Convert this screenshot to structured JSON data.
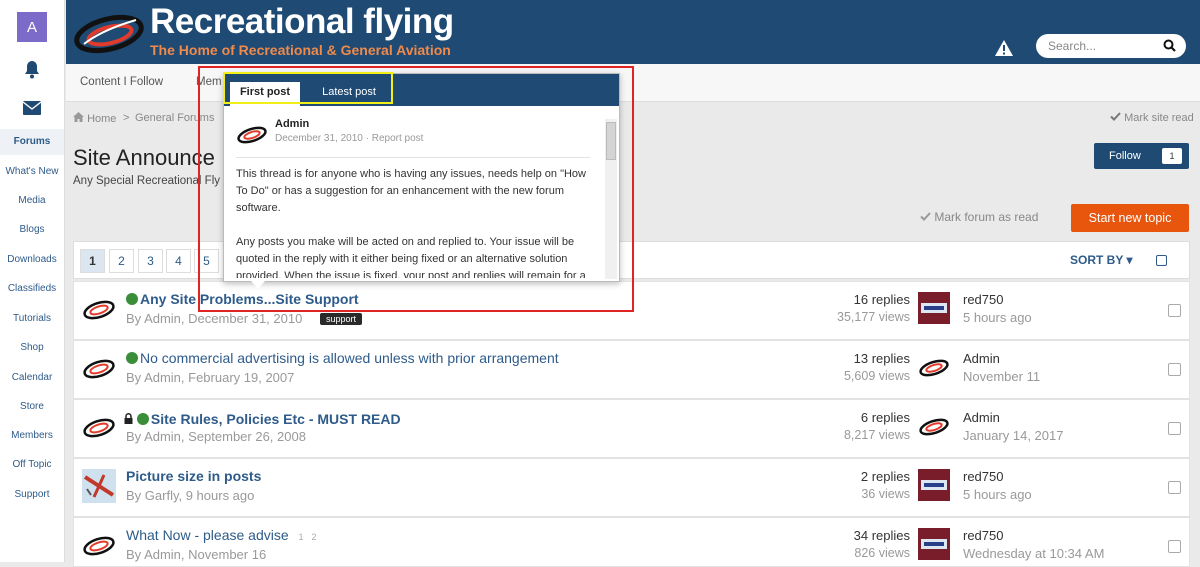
{
  "user": {
    "avatar_letter": "A"
  },
  "sidebar": {
    "items": [
      {
        "label": "Forums",
        "active": true
      },
      {
        "label": "What's New"
      },
      {
        "label": "Media"
      },
      {
        "label": "Blogs"
      },
      {
        "label": "Downloads"
      },
      {
        "label": "Classifieds"
      },
      {
        "label": "Tutorials"
      },
      {
        "label": "Shop"
      },
      {
        "label": "Calendar"
      },
      {
        "label": "Store"
      },
      {
        "label": "Members"
      },
      {
        "label": "Off Topic"
      },
      {
        "label": "Support"
      }
    ]
  },
  "header": {
    "site_title": "Recreational flying",
    "site_subtitle": "The Home of Recreational & General Aviation",
    "search_placeholder": "Search..."
  },
  "subnav": {
    "content_follow": "Content I Follow",
    "member_partial": "Mem"
  },
  "breadcrumb": {
    "home": "Home",
    "sep": ">",
    "general": "General Forums",
    "mark_site_read": "Mark site read"
  },
  "forum": {
    "title": "Site Announce",
    "description": "Any Special Recreational Fly",
    "follow_label": "Follow",
    "follow_count": "1",
    "mark_forum_read": "Mark forum as read",
    "start_topic": "Start new topic",
    "sort_by": "SORT BY ▾",
    "pages": [
      "1",
      "2",
      "3",
      "4",
      "5"
    ]
  },
  "topics": [
    {
      "title": "Any Site Problems...Site Support",
      "meta": "By Admin, December 31, 2010",
      "tag": "support",
      "replies": "16 replies",
      "views": "35,177 views",
      "last_user": "red750",
      "last_time": "5 hours ago"
    },
    {
      "title": "No commercial advertising is allowed unless with prior arrangement",
      "meta": "By Admin, February 19, 2007",
      "replies": "13 replies",
      "views": "5,609 views",
      "last_user": "Admin",
      "last_time": "November 11"
    },
    {
      "title": "Site Rules, Policies Etc - MUST READ",
      "meta": "By Admin, September 26, 2008",
      "replies": "6 replies",
      "views": "8,217 views",
      "last_user": "Admin",
      "last_time": "January 14, 2017"
    },
    {
      "title": "Picture size in posts",
      "meta": "By Garfly, 9 hours ago",
      "replies": "2 replies",
      "views": "36 views",
      "last_user": "red750",
      "last_time": "5 hours ago"
    },
    {
      "title": "What Now - please advise",
      "meta": "By Admin, November 16",
      "pages": [
        "1",
        "2"
      ],
      "replies": "34 replies",
      "views": "826 views",
      "last_user": "red750",
      "last_time": "Wednesday at 10:34 AM"
    }
  ],
  "popup": {
    "tab_first": "First post",
    "tab_latest": "Latest post",
    "author": "Admin",
    "date_line": "December 31, 2010 · Report post",
    "para1": "This thread is for anyone who is having any issues, needs help on \"How To Do\" or has a suggestion for an enhancement with the new forum software.",
    "para2": "Any posts you make will be acted on and replied to. Your issue will be quoted in the reply with it either being fixed or an alternative solution provided. When the issue is fixed, your post and replies will remain for a short period of time as an advisory to other users. They will then be deleted"
  },
  "colors": {
    "header": "#1e4a73",
    "accent": "#e8560e",
    "link": "#2e5b8a",
    "highlight_red": "#e02424",
    "highlight_yellow": "#f2ef16"
  }
}
